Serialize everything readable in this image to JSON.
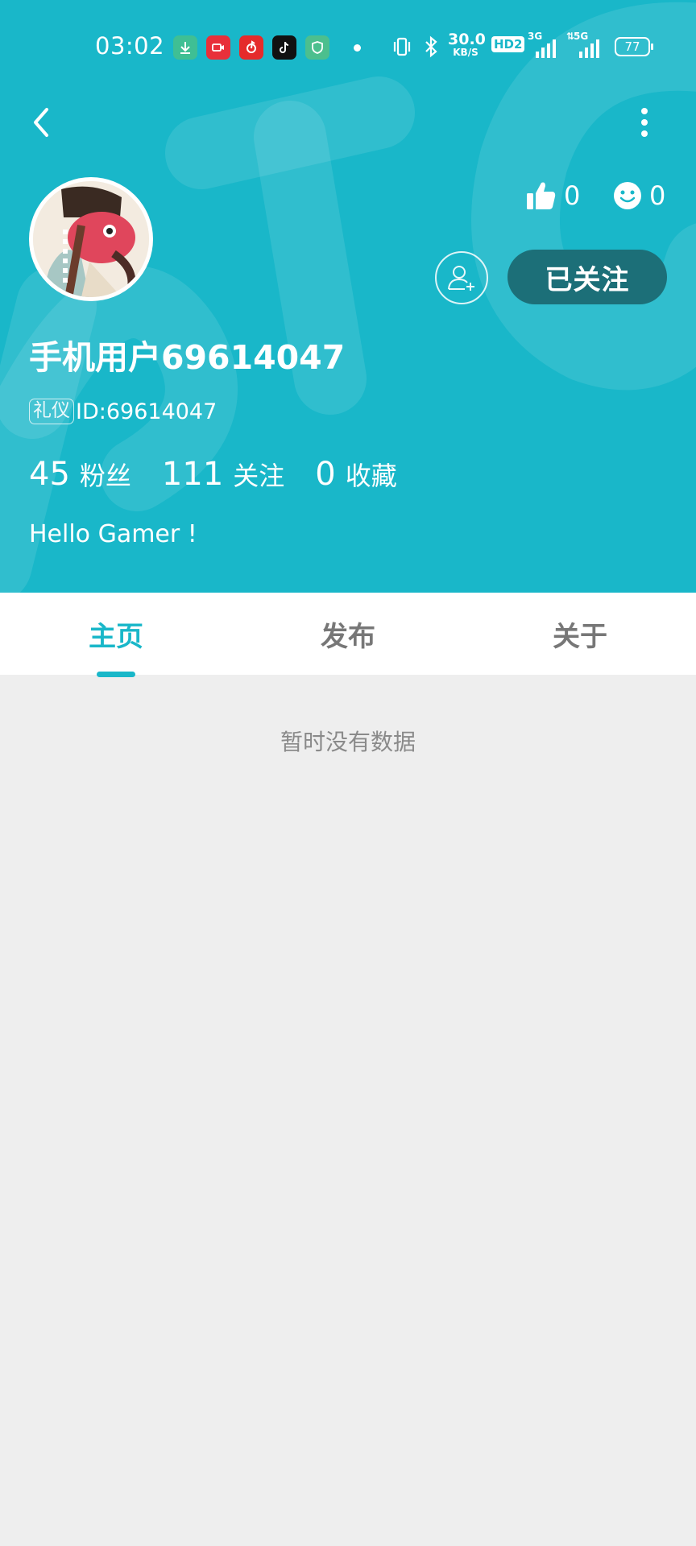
{
  "status_bar": {
    "time": "03:02",
    "net_speed_value": "30.0",
    "net_speed_unit": "KB/S",
    "hd_label": "HD2",
    "signal1_label": "3G",
    "signal2_label": "5G",
    "battery": "77",
    "app_icons": [
      "download-icon",
      "video-record-icon",
      "netease-music-icon",
      "tiktok-icon",
      "shield-icon"
    ]
  },
  "profile": {
    "username": "手机用户69614047",
    "badge": "礼仪",
    "id_text": "ID:69614047",
    "likes": "0",
    "smiles": "0",
    "follow_button": "已关注",
    "bio": "Hello Gamer !",
    "stats": [
      {
        "value": "45",
        "label": "粉丝"
      },
      {
        "value": "111",
        "label": "关注"
      },
      {
        "value": "0",
        "label": "收藏"
      }
    ]
  },
  "tabs": [
    {
      "label": "主页",
      "active": true
    },
    {
      "label": "发布",
      "active": false
    },
    {
      "label": "关于",
      "active": false
    }
  ],
  "content": {
    "empty_text": "暂时没有数据"
  },
  "colors": {
    "accent": "#19b7c9",
    "follow_button_bg": "#1c6f78",
    "page_bg": "#eeeeee"
  }
}
